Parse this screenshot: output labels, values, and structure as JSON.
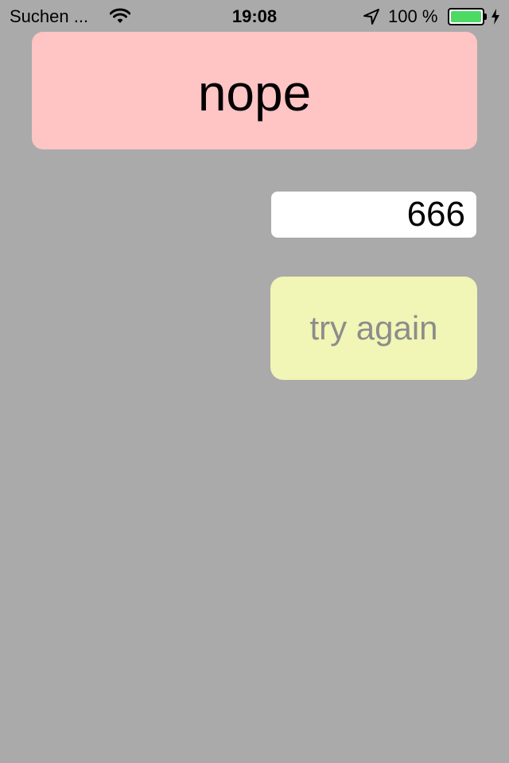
{
  "status_bar": {
    "carrier": "Suchen ...",
    "time": "19:08",
    "battery_percent": "100 %",
    "battery_level": 1.0,
    "icons": [
      "wifi-icon",
      "location-arrow-icon",
      "battery-icon",
      "charging-bolt-icon"
    ],
    "battery_color": "#4cd964"
  },
  "result": {
    "text": "nope",
    "background": "#ffc4c4"
  },
  "guess": {
    "value": "666"
  },
  "retry_button": {
    "label": "try again",
    "background": "#f1f5b5",
    "text_color": "#8c8c8c"
  },
  "colors": {
    "screen_background": "#aaaaaa"
  }
}
